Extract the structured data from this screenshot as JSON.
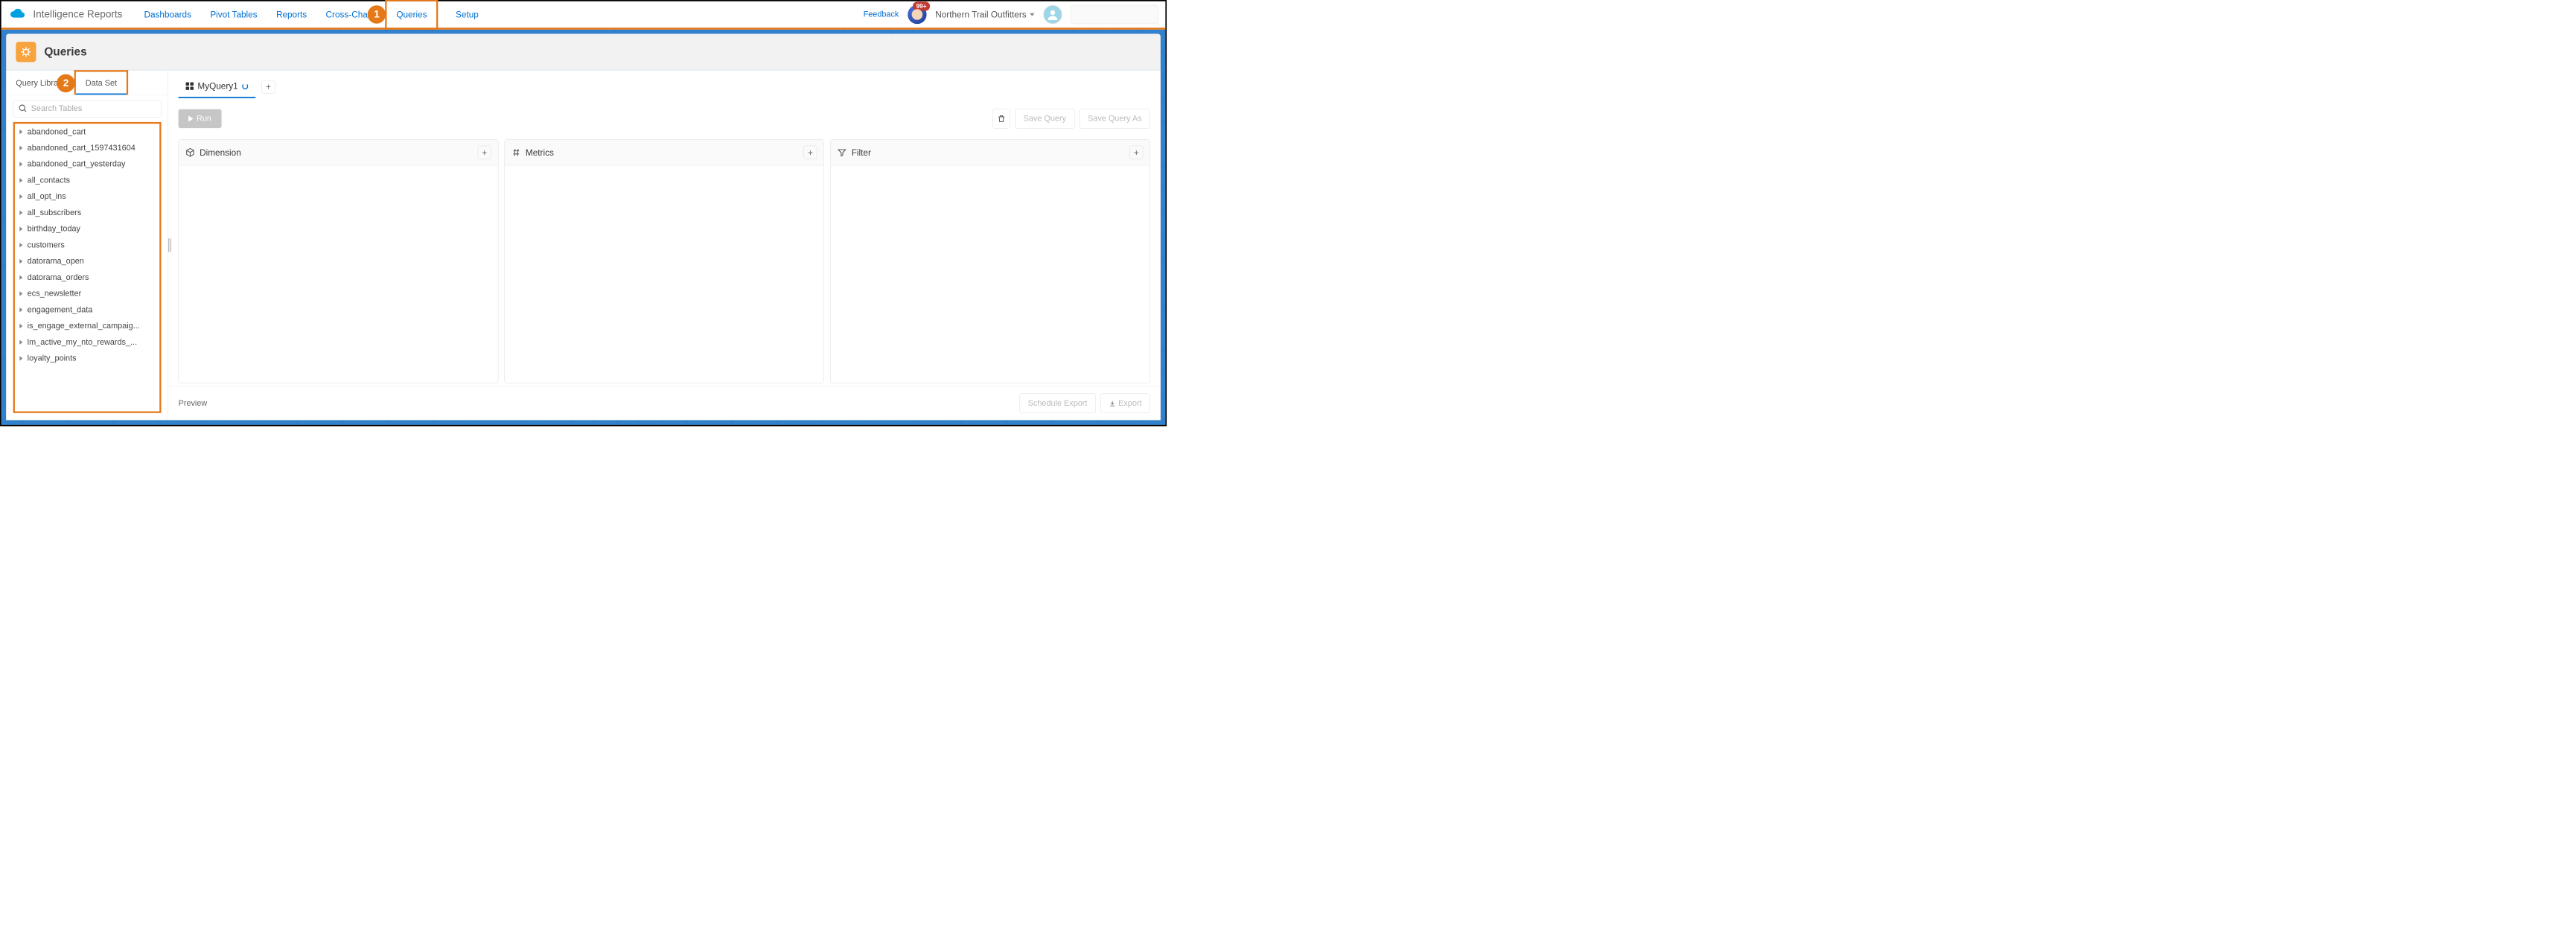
{
  "app": {
    "title": "Intelligence Reports"
  },
  "nav": {
    "items": [
      "Dashboards",
      "Pivot Tables",
      "Reports",
      "Cross-Cha",
      "Queries",
      "Setup"
    ],
    "active_index": 4
  },
  "topright": {
    "feedback": "Feedback",
    "badge": "99+",
    "org_name": "Northern Trail Outfitters"
  },
  "callouts": {
    "one": "1",
    "two": "2"
  },
  "page": {
    "title": "Queries"
  },
  "sidebar": {
    "tabs": {
      "library": "Query Library",
      "dataset": "Data Set"
    },
    "search_placeholder": "Search Tables",
    "tables": [
      "abandoned_cart",
      "abandoned_cart_1597431604",
      "abandoned_cart_yesterday",
      "all_contacts",
      "all_opt_ins",
      "all_subscribers",
      "birthday_today",
      "customers",
      "datorama_open",
      "datorama_orders",
      "ecs_newsletter",
      "engagement_data",
      "is_engage_external_campaig...",
      "lm_active_my_nto_rewards_...",
      "loyalty_points"
    ]
  },
  "editor": {
    "tab_name": "MyQuery1",
    "add_tab": "+",
    "run": "Run",
    "delete_tooltip": "Delete",
    "save": "Save Query",
    "save_as": "Save Query As"
  },
  "panels": {
    "dimension": "Dimension",
    "metrics": "Metrics",
    "filter": "Filter",
    "add": "+"
  },
  "footer": {
    "preview": "Preview",
    "schedule": "Schedule Export",
    "export": "Export"
  }
}
